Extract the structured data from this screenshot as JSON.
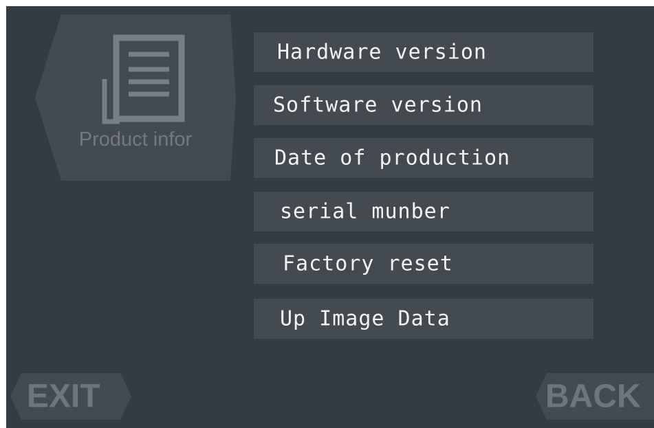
{
  "product_panel": {
    "label": "Product infor",
    "icon": "document-icon"
  },
  "menu": {
    "items": [
      {
        "label": "Hardware version"
      },
      {
        "label": "Software version"
      },
      {
        "label": "Date of production"
      },
      {
        "label": "serial munber"
      },
      {
        "label": "Factory reset"
      },
      {
        "label": "Up Image Data"
      }
    ]
  },
  "footer": {
    "exit_label": "EXIT",
    "back_label": "BACK"
  },
  "colors": {
    "background": "#343b41",
    "panel": "#434a50",
    "text": "#f2f2f2",
    "muted_text": "#727a80"
  }
}
